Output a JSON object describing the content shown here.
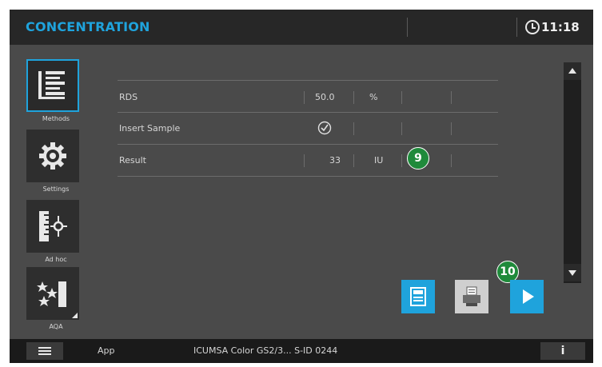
{
  "header": {
    "title": "CONCENTRATION",
    "time": "11:18"
  },
  "sidebar": {
    "items": [
      {
        "label": "Methods",
        "icon": "methods-list-icon",
        "active": true
      },
      {
        "label": "Settings",
        "icon": "gear-icon",
        "active": false
      },
      {
        "label": "Ad hoc",
        "icon": "adhoc-ruler-icon",
        "active": false
      },
      {
        "label": "AQA",
        "icon": "stars-check-icon",
        "active": false
      }
    ]
  },
  "table": {
    "rows": [
      {
        "label": "RDS",
        "value": "50.0",
        "unit": "%"
      },
      {
        "label": "Insert Sample",
        "value_icon": "check-circle-icon"
      },
      {
        "label": "Result",
        "value": "33",
        "unit": "IU"
      }
    ]
  },
  "annotations": {
    "badge_9": "9",
    "badge_10": "10"
  },
  "actions": {
    "save_icon": "save-icon",
    "print_icon": "printer-icon",
    "run_icon": "play-icon"
  },
  "footer": {
    "app_label": "App",
    "method": "ICUMSA Color GS2/3... S-ID 0244",
    "info_label": "i"
  },
  "colors": {
    "accent": "#1fa3dc",
    "background": "#4a4a4a",
    "header": "#272727",
    "badge": "#1f8a3b"
  }
}
